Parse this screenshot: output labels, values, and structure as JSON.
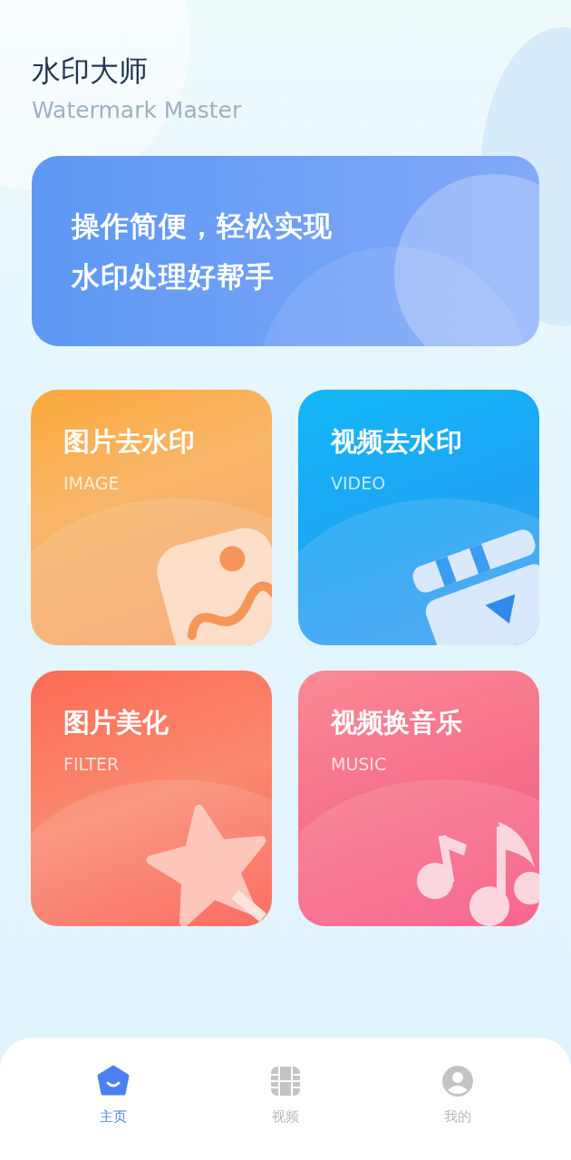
{
  "header": {
    "title": "水印大师",
    "subtitle": "Watermark Master"
  },
  "banner": {
    "lines": [
      "操作简便，轻松实现",
      "水印处理好帮手"
    ]
  },
  "cards": [
    {
      "kind": "image",
      "title": "图片去水印",
      "subtitle": "IMAGE"
    },
    {
      "kind": "video",
      "title": "视频去水印",
      "subtitle": "VIDEO"
    },
    {
      "kind": "filter",
      "title": "图片美化",
      "subtitle": "FILTER"
    },
    {
      "kind": "music",
      "title": "视频换音乐",
      "subtitle": "MUSIC"
    }
  ],
  "tabs": [
    {
      "kind": "home",
      "label": "主页",
      "selected": true
    },
    {
      "kind": "video",
      "label": "视频",
      "selected": false
    },
    {
      "kind": "profile",
      "label": "我的",
      "selected": false
    }
  ]
}
